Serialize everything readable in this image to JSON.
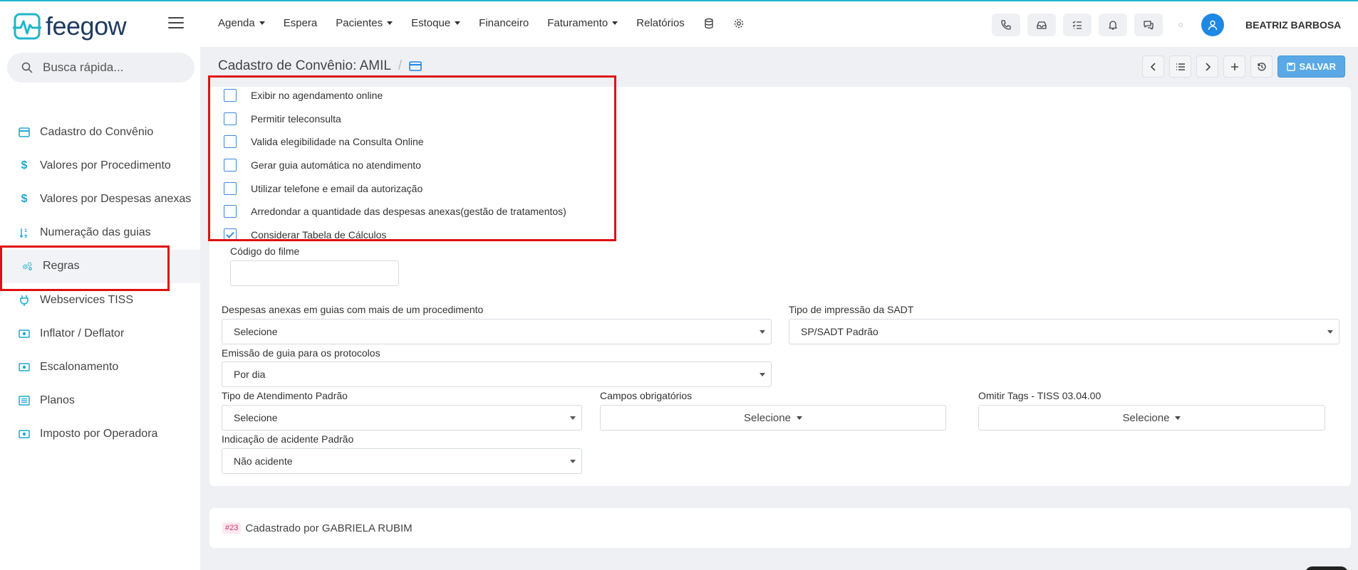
{
  "brand": {
    "name": "feegow",
    "accent": "#1fb6c9",
    "primary": "#1e88e5"
  },
  "nav": [
    {
      "label": "Agenda",
      "dropdown": true
    },
    {
      "label": "Espera",
      "dropdown": false
    },
    {
      "label": "Pacientes",
      "dropdown": true
    },
    {
      "label": "Estoque",
      "dropdown": true
    },
    {
      "label": "Financeiro",
      "dropdown": false
    },
    {
      "label": "Faturamento",
      "dropdown": true
    },
    {
      "label": "Relatórios",
      "dropdown": false
    }
  ],
  "header": {
    "user_name": "BEATRIZ BARBOSA"
  },
  "search": {
    "placeholder": "Busca rápida..."
  },
  "sidebar": {
    "items": [
      {
        "label": "Cadastro do Convênio",
        "icon": "card-icon"
      },
      {
        "label": "Valores por Procedimento",
        "icon": "dollar-icon"
      },
      {
        "label": "Valores por Despesas anexas",
        "icon": "dollar-icon"
      },
      {
        "label": "Numeração das guias",
        "icon": "sort-numeric-icon"
      },
      {
        "label": "Regras",
        "icon": "cogs-icon",
        "active": true
      },
      {
        "label": "Webservices TISS",
        "icon": "plug-icon"
      },
      {
        "label": "Inflator / Deflator",
        "icon": "money-icon"
      },
      {
        "label": "Escalonamento",
        "icon": "money-icon"
      },
      {
        "label": "Planos",
        "icon": "list-icon"
      },
      {
        "label": "Imposto por Operadora",
        "icon": "money-icon"
      }
    ]
  },
  "page": {
    "title": "Cadastro de Convênio: AMIL",
    "separator": "/",
    "save_label": "SALVAR"
  },
  "checkboxes": [
    {
      "label": "Exibir no agendamento online",
      "checked": false
    },
    {
      "label": "Permitir teleconsulta",
      "checked": false
    },
    {
      "label": "Valida elegibilidade na Consulta Online",
      "checked": false
    },
    {
      "label": "Gerar guia automática no atendimento",
      "checked": false
    },
    {
      "label": "Utilizar telefone e email da autorização",
      "checked": false
    },
    {
      "label": "Arredondar a quantidade das despesas anexas(gestão de tratamentos)",
      "checked": false
    },
    {
      "label": "Considerar Tabela de Cálculos",
      "checked": true
    }
  ],
  "form": {
    "codigo_filme_label": "Código do filme",
    "codigo_filme_value": "",
    "despesas_label": "Despesas anexas em guias com mais de um procedimento",
    "despesas_value": "Selecione",
    "impressao_label": "Tipo de impressão da SADT",
    "impressao_value": "SP/SADT Padrão",
    "emissao_label": "Emissão de guia para os protocolos",
    "emissao_value": "Por dia",
    "atendimento_label": "Tipo de Atendimento Padrão",
    "atendimento_value": "Selecione",
    "campos_label": "Campos obrigatórios",
    "campos_value": "Selecione",
    "omitir_label": "Omitir Tags - TISS 03.04.00",
    "omitir_value": "Selecione",
    "acidente_label": "Indicação de acidente Padrão",
    "acidente_value": "Não acidente"
  },
  "footer": {
    "tag": "#23",
    "text": "Cadastrado por GABRIELA RUBIM"
  }
}
